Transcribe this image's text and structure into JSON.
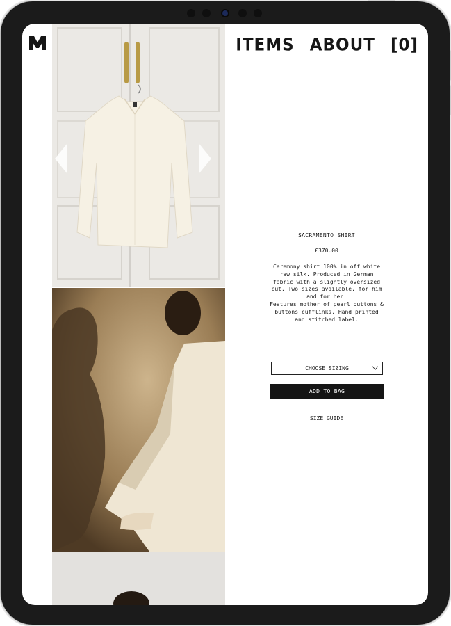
{
  "brand": {
    "logo_icon": "m-logo-icon"
  },
  "nav": {
    "items": [
      "ITEMS",
      "ABOUT",
      "[0]"
    ]
  },
  "gallery": {
    "prev_icon": "chevron-left-icon",
    "next_icon": "chevron-right-icon"
  },
  "product": {
    "name": "SACRAMENTO SHIRT",
    "price": "€370.00",
    "description_lines": [
      "Ceremony shirt 100% in off white",
      "raw silk. Produced in German",
      "fabric with a slightly oversized",
      "cut. Two sizes available, for him",
      "and for her.",
      "Features mother of pearl buttons &",
      "buttons cufflinks. Hand printed",
      "and stitched label."
    ],
    "size_select_label": "CHOOSE SIZING",
    "add_to_bag_label": "ADD TO BAG",
    "size_guide_label": "SIZE GUIDE"
  },
  "colors": {
    "ink": "#151515",
    "background": "#ffffff"
  }
}
